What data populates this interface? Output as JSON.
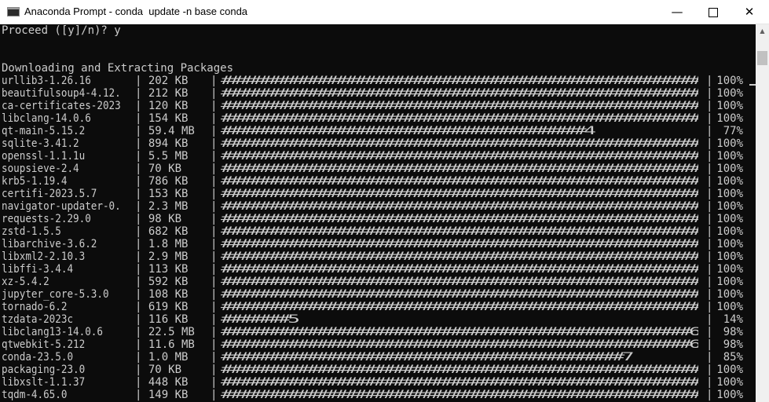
{
  "window": {
    "title": "Anaconda Prompt - conda  update -n base conda",
    "minimize": "—",
    "close": "✕"
  },
  "console": {
    "prompt_line": "Proceed ([y]/n)? y",
    "header": "Downloading and Extracting Packages",
    "packages": [
      {
        "name": "urllib3-1.26.16",
        "size": "202 KB",
        "bar": "##################################################",
        "pct": "100%"
      },
      {
        "name": "beautifulsoup4-4.12.",
        "size": "212 KB",
        "bar": "##################################################",
        "pct": "100%"
      },
      {
        "name": "ca-certificates-2023",
        "size": "120 KB",
        "bar": "##################################################",
        "pct": "100%"
      },
      {
        "name": "libclang-14.0.6",
        "size": "154 KB",
        "bar": "##################################################",
        "pct": "100%"
      },
      {
        "name": "qt-main-5.15.2",
        "size": "59.4 MB",
        "bar": "######################################4",
        "pct": "77%"
      },
      {
        "name": "sqlite-3.41.2",
        "size": "894 KB",
        "bar": "##################################################",
        "pct": "100%"
      },
      {
        "name": "openssl-1.1.1u",
        "size": "5.5 MB",
        "bar": "##################################################",
        "pct": "100%"
      },
      {
        "name": "soupsieve-2.4",
        "size": "70 KB",
        "bar": "##################################################",
        "pct": "100%"
      },
      {
        "name": "krb5-1.19.4",
        "size": "786 KB",
        "bar": "##################################################",
        "pct": "100%"
      },
      {
        "name": "certifi-2023.5.7",
        "size": "153 KB",
        "bar": "##################################################",
        "pct": "100%"
      },
      {
        "name": "navigator-updater-0.",
        "size": "2.3 MB",
        "bar": "##################################################",
        "pct": "100%"
      },
      {
        "name": "requests-2.29.0",
        "size": "98 KB",
        "bar": "##################################################",
        "pct": "100%"
      },
      {
        "name": "zstd-1.5.5",
        "size": "682 KB",
        "bar": "##################################################",
        "pct": "100%"
      },
      {
        "name": "libarchive-3.6.2",
        "size": "1.8 MB",
        "bar": "##################################################",
        "pct": "100%"
      },
      {
        "name": "libxml2-2.10.3",
        "size": "2.9 MB",
        "bar": "##################################################",
        "pct": "100%"
      },
      {
        "name": "libffi-3.4.4",
        "size": "113 KB",
        "bar": "##################################################",
        "pct": "100%"
      },
      {
        "name": "xz-5.4.2",
        "size": "592 KB",
        "bar": "##################################################",
        "pct": "100%"
      },
      {
        "name": "jupyter_core-5.3.0",
        "size": "108 KB",
        "bar": "##################################################",
        "pct": "100%"
      },
      {
        "name": "tornado-6.2",
        "size": "619 KB",
        "bar": "##################################################",
        "pct": "100%"
      },
      {
        "name": "tzdata-2023c",
        "size": "116 KB",
        "bar": "#######5",
        "pct": "14%"
      },
      {
        "name": "libclang13-14.0.6",
        "size": "22.5 MB",
        "bar": "#################################################6",
        "pct": "98%"
      },
      {
        "name": "qtwebkit-5.212",
        "size": "11.6 MB",
        "bar": "#################################################6",
        "pct": "98%"
      },
      {
        "name": "conda-23.5.0",
        "size": "1.0 MB",
        "bar": "##########################################7",
        "pct": "85%"
      },
      {
        "name": "packaging-23.0",
        "size": "70 KB",
        "bar": "##################################################",
        "pct": "100%"
      },
      {
        "name": "libxslt-1.1.37",
        "size": "448 KB",
        "bar": "##################################################",
        "pct": "100%"
      },
      {
        "name": "tqdm-4.65.0",
        "size": "149 KB",
        "bar": "##################################################",
        "pct": "100%"
      }
    ]
  }
}
